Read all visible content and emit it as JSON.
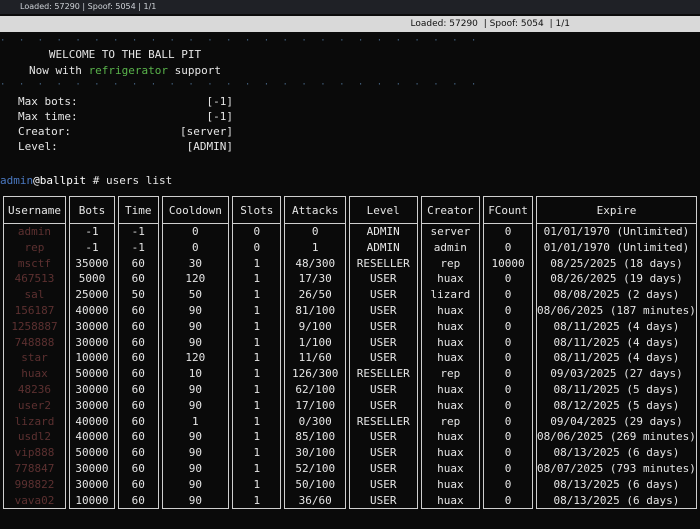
{
  "topbar": {
    "text": "Loaded: 57290 | Spoof: 5054 | 1/1"
  },
  "titlebar": {
    "loaded": "Loaded: 57290",
    "spoof": "Spoof: 5054",
    "page": "1/1"
  },
  "banner": {
    "line1": "WELCOME TO THE BALL PIT",
    "line2_prefix": "Now with ",
    "line2_highlight": "refrigerator",
    "line2_suffix": " support"
  },
  "info": [
    {
      "label": "Max bots:",
      "value": "[-1]"
    },
    {
      "label": "Max time:",
      "value": "[-1]"
    },
    {
      "label": "Creator:",
      "value": "[server]"
    },
    {
      "label": "Level:",
      "value": "[ADMIN]"
    }
  ],
  "prompt": {
    "user": "admin",
    "host": "@ballpit",
    "command": " # users list"
  },
  "table": {
    "headers": [
      "Username",
      "Bots",
      "Time",
      "Cooldown",
      "Slots",
      "Attacks",
      "Level",
      "Creator",
      "FCount",
      "Expire"
    ],
    "rows": [
      [
        "admin",
        "-1",
        "-1",
        "0",
        "0",
        "0",
        "ADMIN",
        "server",
        "0",
        "01/01/1970 (Unlimited)"
      ],
      [
        "rep",
        "-1",
        "-1",
        "0",
        "0",
        "1",
        "ADMIN",
        "admin",
        "0",
        "01/01/1970 (Unlimited)"
      ],
      [
        "msctf",
        "35000",
        "60",
        "30",
        "1",
        "48/300",
        "RESELLER",
        "rep",
        "10000",
        "08/25/2025 (18 days)"
      ],
      [
        "467513",
        "5000",
        "60",
        "120",
        "1",
        "17/30",
        "USER",
        "huax",
        "0",
        "08/26/2025 (19 days)"
      ],
      [
        "sal",
        "25000",
        "50",
        "50",
        "1",
        "26/50",
        "USER",
        "lizard",
        "0",
        "08/08/2025 (2 days)"
      ],
      [
        "156187",
        "40000",
        "60",
        "90",
        "1",
        "81/100",
        "USER",
        "huax",
        "0",
        "08/06/2025 (187 minutes)"
      ],
      [
        "1258887",
        "30000",
        "60",
        "90",
        "1",
        "9/100",
        "USER",
        "huax",
        "0",
        "08/11/2025 (4 days)"
      ],
      [
        "748888",
        "30000",
        "60",
        "90",
        "1",
        "1/100",
        "USER",
        "huax",
        "0",
        "08/11/2025 (4 days)"
      ],
      [
        "star",
        "10000",
        "60",
        "120",
        "1",
        "11/60",
        "USER",
        "huax",
        "0",
        "08/11/2025 (4 days)"
      ],
      [
        "huax",
        "50000",
        "60",
        "10",
        "1",
        "126/300",
        "RESELLER",
        "rep",
        "0",
        "09/03/2025 (27 days)"
      ],
      [
        "48236",
        "30000",
        "60",
        "90",
        "1",
        "62/100",
        "USER",
        "huax",
        "0",
        "08/11/2025 (5 days)"
      ],
      [
        "user2",
        "30000",
        "60",
        "90",
        "1",
        "17/100",
        "USER",
        "huax",
        "0",
        "08/12/2025 (5 days)"
      ],
      [
        "lizard",
        "40000",
        "60",
        "1",
        "1",
        "0/300",
        "RESELLER",
        "rep",
        "0",
        "09/04/2025 (29 days)"
      ],
      [
        "usdl2",
        "40000",
        "60",
        "90",
        "1",
        "85/100",
        "USER",
        "huax",
        "0",
        "08/06/2025 (269 minutes)"
      ],
      [
        "vip888",
        "50000",
        "60",
        "90",
        "1",
        "30/100",
        "USER",
        "huax",
        "0",
        "08/13/2025 (6 days)"
      ],
      [
        "778847",
        "30000",
        "60",
        "90",
        "1",
        "52/100",
        "USER",
        "huax",
        "0",
        "08/07/2025 (793 minutes)"
      ],
      [
        "998822",
        "30000",
        "60",
        "90",
        "1",
        "50/100",
        "USER",
        "huax",
        "0",
        "08/13/2025 (6 days)"
      ],
      [
        "vava02",
        "10000",
        "60",
        "90",
        "1",
        "36/60",
        "USER",
        "huax",
        "0",
        "08/13/2025 (6 days)"
      ]
    ]
  },
  "colors": {
    "background": "#0a0a0a",
    "text": "#e6e6e6",
    "highlight": "#59b34b",
    "prompt_user": "#4a78c0",
    "username": "#5c3030"
  }
}
